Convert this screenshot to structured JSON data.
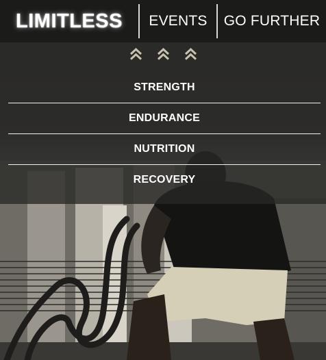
{
  "header": {
    "logo": "LIMITLESS",
    "links": [
      {
        "label": "EVENTS"
      },
      {
        "label": "GO FURTHER"
      }
    ]
  },
  "collapse_icon": "double-chevron-up-icon",
  "menu": {
    "items": [
      {
        "label": "STRENGTH"
      },
      {
        "label": "ENDURANCE"
      },
      {
        "label": "NUTRITION"
      },
      {
        "label": "RECOVERY"
      }
    ]
  },
  "colors": {
    "nav_bg": "#1b1b1a",
    "chevron": "#c9c2b0",
    "text": "#ffffff"
  }
}
